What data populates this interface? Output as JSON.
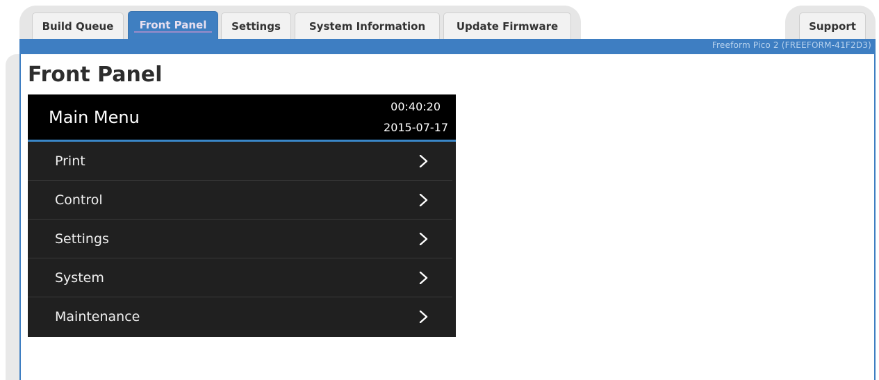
{
  "tabs": [
    {
      "label": "Build Queue",
      "active": false
    },
    {
      "label": "Front Panel",
      "active": true
    },
    {
      "label": "Settings",
      "active": false
    },
    {
      "label": "System Information",
      "active": false
    },
    {
      "label": "Update Firmware",
      "active": false
    }
  ],
  "support_tab": {
    "label": "Support"
  },
  "device_label": "Freeform Pico 2 (FREEFORM-41F2D3)",
  "page_title": "Front Panel",
  "panel": {
    "title": "Main Menu",
    "time": "00:40:20",
    "date": "2015-07-17",
    "menu_items": [
      {
        "label": "Print",
        "icon": "chevron-right-icon"
      },
      {
        "label": "Control",
        "icon": "chevron-right-icon"
      },
      {
        "label": "Settings",
        "icon": "chevron-right-icon"
      },
      {
        "label": "System",
        "icon": "chevron-right-icon"
      },
      {
        "label": "Maintenance",
        "icon": "chevron-right-icon"
      }
    ]
  },
  "colors": {
    "accent": "#3e7ec2",
    "panel_background": "#202020",
    "panel_header": "#000000"
  }
}
